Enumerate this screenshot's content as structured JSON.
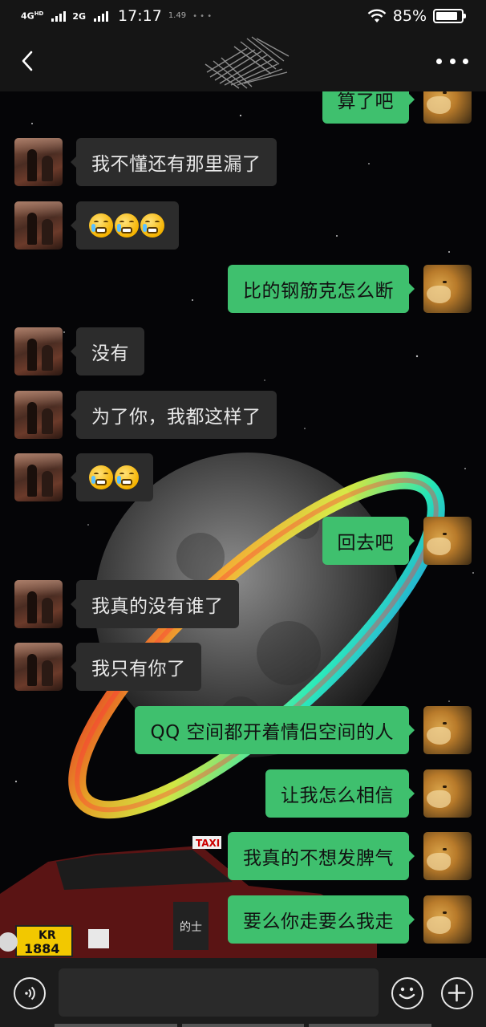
{
  "status_bar": {
    "network_1": "4G",
    "network_1_sup": "HD",
    "network_2": "2G",
    "time": "17:17",
    "speed": "1.49",
    "battery": "85%",
    "battery_level": 0.85
  },
  "nav": {
    "back_icon": "chevron-left-icon",
    "more_icon": "more-horizontal-icon"
  },
  "messages": [
    {
      "side": "right",
      "text": "算了吧"
    },
    {
      "side": "left",
      "text": "我不懂还有那里漏了"
    },
    {
      "side": "left",
      "emoji": "crying-face-icon",
      "emoji_count": 3
    },
    {
      "side": "right",
      "text": "比的钢筋克怎么断"
    },
    {
      "side": "left",
      "text": "没有"
    },
    {
      "side": "left",
      "text": "为了你，我都这样了"
    },
    {
      "side": "left",
      "emoji": "crying-face-icon",
      "emoji_count": 2
    },
    {
      "side": "right",
      "text": "回去吧"
    },
    {
      "side": "left",
      "text": "我真的没有谁了"
    },
    {
      "side": "left",
      "text": "我只有你了"
    },
    {
      "side": "right",
      "text": "QQ 空间都开着情侣空间的人"
    },
    {
      "side": "right",
      "text": "让我怎么相信"
    },
    {
      "side": "right",
      "text": "我真的不想发脾气"
    },
    {
      "side": "right",
      "text": "要么你走要么我走"
    }
  ],
  "background_text": {
    "taxi_sign": "TAXI",
    "plate_top": "KR",
    "plate_bottom": "1884",
    "door_text": "的士"
  },
  "input_bar": {
    "placeholder": "",
    "voice_icon": "voice-icon",
    "emoji_icon": "smiley-icon",
    "plus_icon": "plus-icon"
  },
  "colors": {
    "sent_bubble": "#3fc06e",
    "received_bubble": "#2c2c2c",
    "bar_background": "#151515"
  }
}
